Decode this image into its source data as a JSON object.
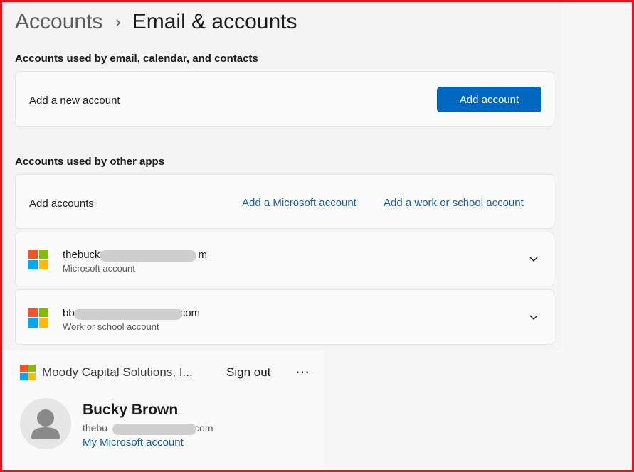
{
  "breadcrumb": {
    "parent": "Accounts",
    "separator": "›",
    "current": "Email & accounts"
  },
  "email_section": {
    "title": "Accounts used by email, calendar, and contacts",
    "row_label": "Add a new account",
    "button_label": "Add account"
  },
  "other_apps_section": {
    "title": "Accounts used by other apps",
    "row_label": "Add accounts",
    "link_microsoft": "Add a Microsoft account",
    "link_work": "Add a work or school account"
  },
  "accounts": [
    {
      "email_prefix": "thebuck",
      "email_suffix": "m",
      "type": "Microsoft account",
      "icon": "microsoft-logo-icon"
    },
    {
      "email_prefix": "bb",
      "email_suffix": "com",
      "type": "Work or school account",
      "icon": "microsoft-logo-icon"
    }
  ],
  "flyout": {
    "org": "Moody Capital Solutions, I...",
    "sign_out": "Sign out",
    "more": "⋯",
    "user_name": "Bucky Brown",
    "email_prefix": "thebu",
    "email_suffix": "com",
    "my_account_link": "My Microsoft account",
    "avatar_icon": "person-icon"
  },
  "colors": {
    "accent": "#0067c0",
    "link": "#1a5fa3",
    "frame": "#e8141b"
  }
}
